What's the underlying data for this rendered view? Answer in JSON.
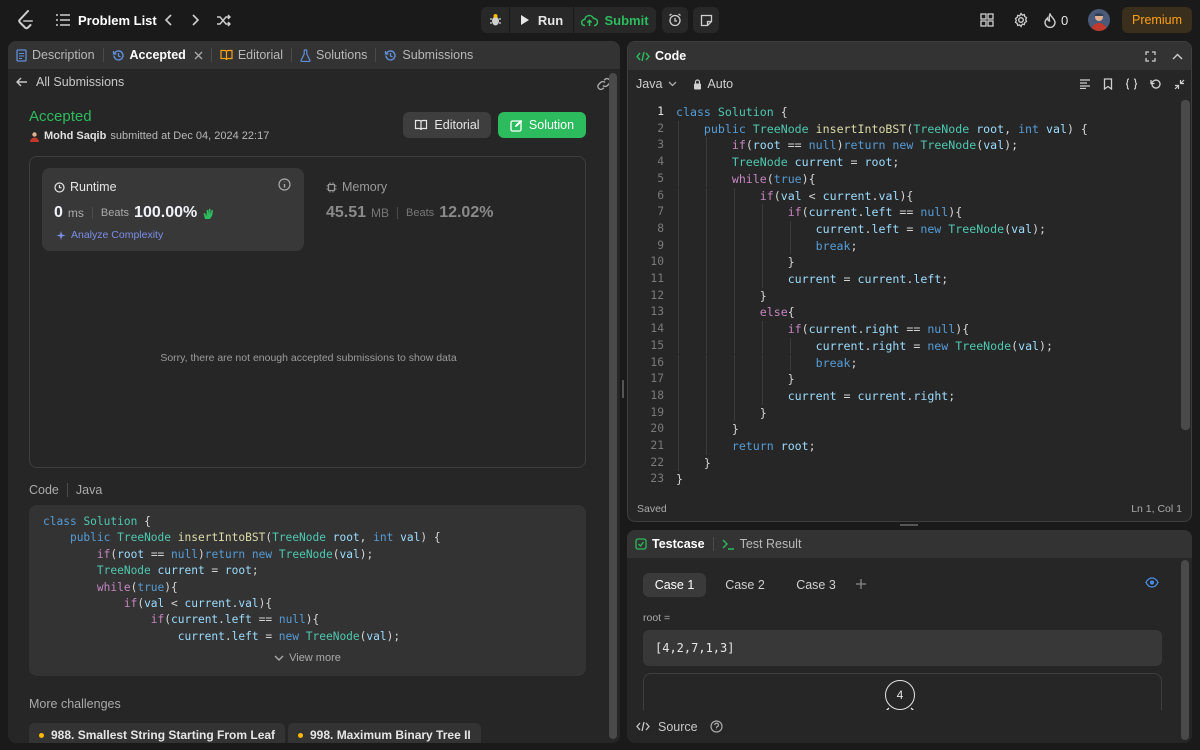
{
  "topbar": {
    "problem_list": "Problem List",
    "run": "Run",
    "submit": "Submit",
    "streak_count": "0",
    "premium": "Premium"
  },
  "left_tabs": [
    {
      "label": "Description",
      "icon": "description-icon"
    },
    {
      "label": "Accepted",
      "icon": "history-icon"
    },
    {
      "label": "Editorial",
      "icon": "book-icon"
    },
    {
      "label": "Solutions",
      "icon": "flask-icon"
    },
    {
      "label": "Submissions",
      "icon": "history-icon"
    }
  ],
  "submission": {
    "back_label": "All Submissions",
    "status": "Accepted",
    "user": "Mohd Saqib",
    "submitted_text": "submitted at Dec 04, 2024 22:17",
    "editorial_btn": "Editorial",
    "solution_btn": "Solution"
  },
  "runtime": {
    "label": "Runtime",
    "value": "0",
    "unit": "ms",
    "beats_label": "Beats",
    "beats_value": "100.00%",
    "analyze": "Analyze Complexity"
  },
  "memory": {
    "label": "Memory",
    "value": "45.51",
    "unit": "MB",
    "beats_label": "Beats",
    "beats_value": "12.02%"
  },
  "no_data_msg": "Sorry, there are not enough accepted submissions to show data",
  "code_section": {
    "label": "Code",
    "language": "Java",
    "view_more": "View more",
    "preview_lines": [
      "class Solution {",
      "    public TreeNode insertIntoBST(TreeNode root, int val) {",
      "        if(root == null)return new TreeNode(val);",
      "        TreeNode current = root;",
      "        while(true){",
      "            if(val < current.val){",
      "                if(current.left == null){",
      "                    current.left = new TreeNode(val);"
    ]
  },
  "more_challenges": {
    "label": "More challenges",
    "items": [
      "988. Smallest String Starting From Leaf",
      "998. Maximum Binary Tree II"
    ]
  },
  "editor": {
    "title": "Code",
    "language": "Java",
    "mode": "Auto",
    "status_left": "Saved",
    "status_right": "Ln 1, Col 1",
    "lines": [
      "class Solution {",
      "    public TreeNode insertIntoBST(TreeNode root, int val) {",
      "        if(root == null)return new TreeNode(val);",
      "        TreeNode current = root;",
      "        while(true){",
      "            if(val < current.val){",
      "                if(current.left == null){",
      "                    current.left = new TreeNode(val);",
      "                    break;",
      "                }",
      "                current = current.left;",
      "            }",
      "            else{",
      "                if(current.right == null){",
      "                    current.right = new TreeNode(val);",
      "                    break;",
      "                }",
      "                current = current.right;",
      "            }",
      "        }",
      "        return root;",
      "    }",
      "}"
    ]
  },
  "testcase": {
    "tab": "Testcase",
    "result_tab": "Test Result",
    "cases": [
      "Case 1",
      "Case 2",
      "Case 3"
    ],
    "root_label": "root =",
    "root_value": "[4,2,7,1,3]",
    "tree_root": "4",
    "source": "Source"
  },
  "colors": {
    "accent_green": "#2cbb5d",
    "premium_orange": "#ffa116",
    "panel_bg": "#262626"
  }
}
